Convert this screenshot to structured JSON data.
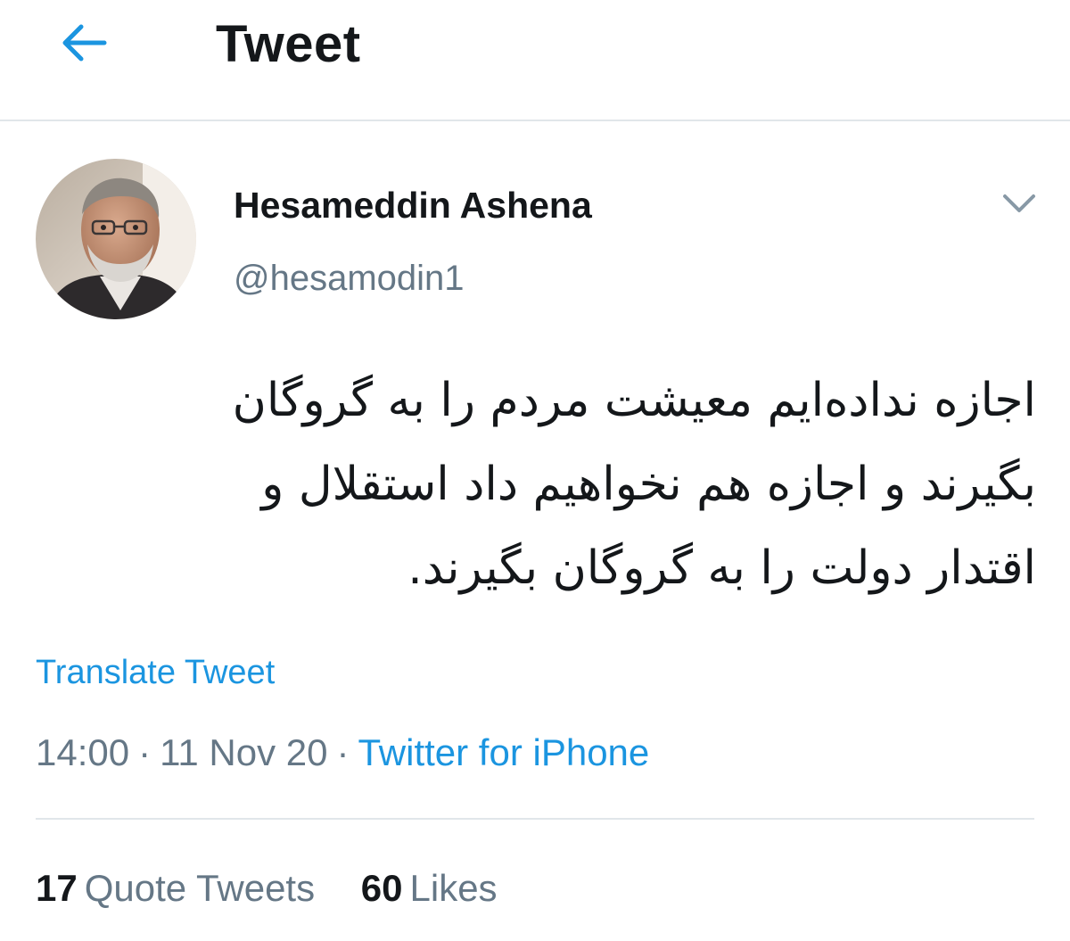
{
  "header": {
    "title": "Tweet",
    "back_icon": "arrow-left-icon",
    "accent_color": "#1b95e0"
  },
  "author": {
    "display_name": "Hesameddin Ashena",
    "handle": "@hesamodin1",
    "avatar": "avatar-photo"
  },
  "menu": {
    "icon": "chevron-down-icon"
  },
  "tweet": {
    "lines": [
      "اجازه نداده‌ایم معیشت مردم را به گروگان",
      "بگیرند و اجازه  هم نخواهیم داد استقلال و",
      "اقتدار دولت را به گروگان بگیرند."
    ],
    "translate_label": "Translate Tweet"
  },
  "meta": {
    "time": "14:00",
    "separator": "·",
    "date": "11 Nov 20",
    "source": "Twitter for iPhone"
  },
  "stats": {
    "quote_count": "17",
    "quote_label": "Quote Tweets",
    "likes_count": "60",
    "likes_label": "Likes"
  }
}
